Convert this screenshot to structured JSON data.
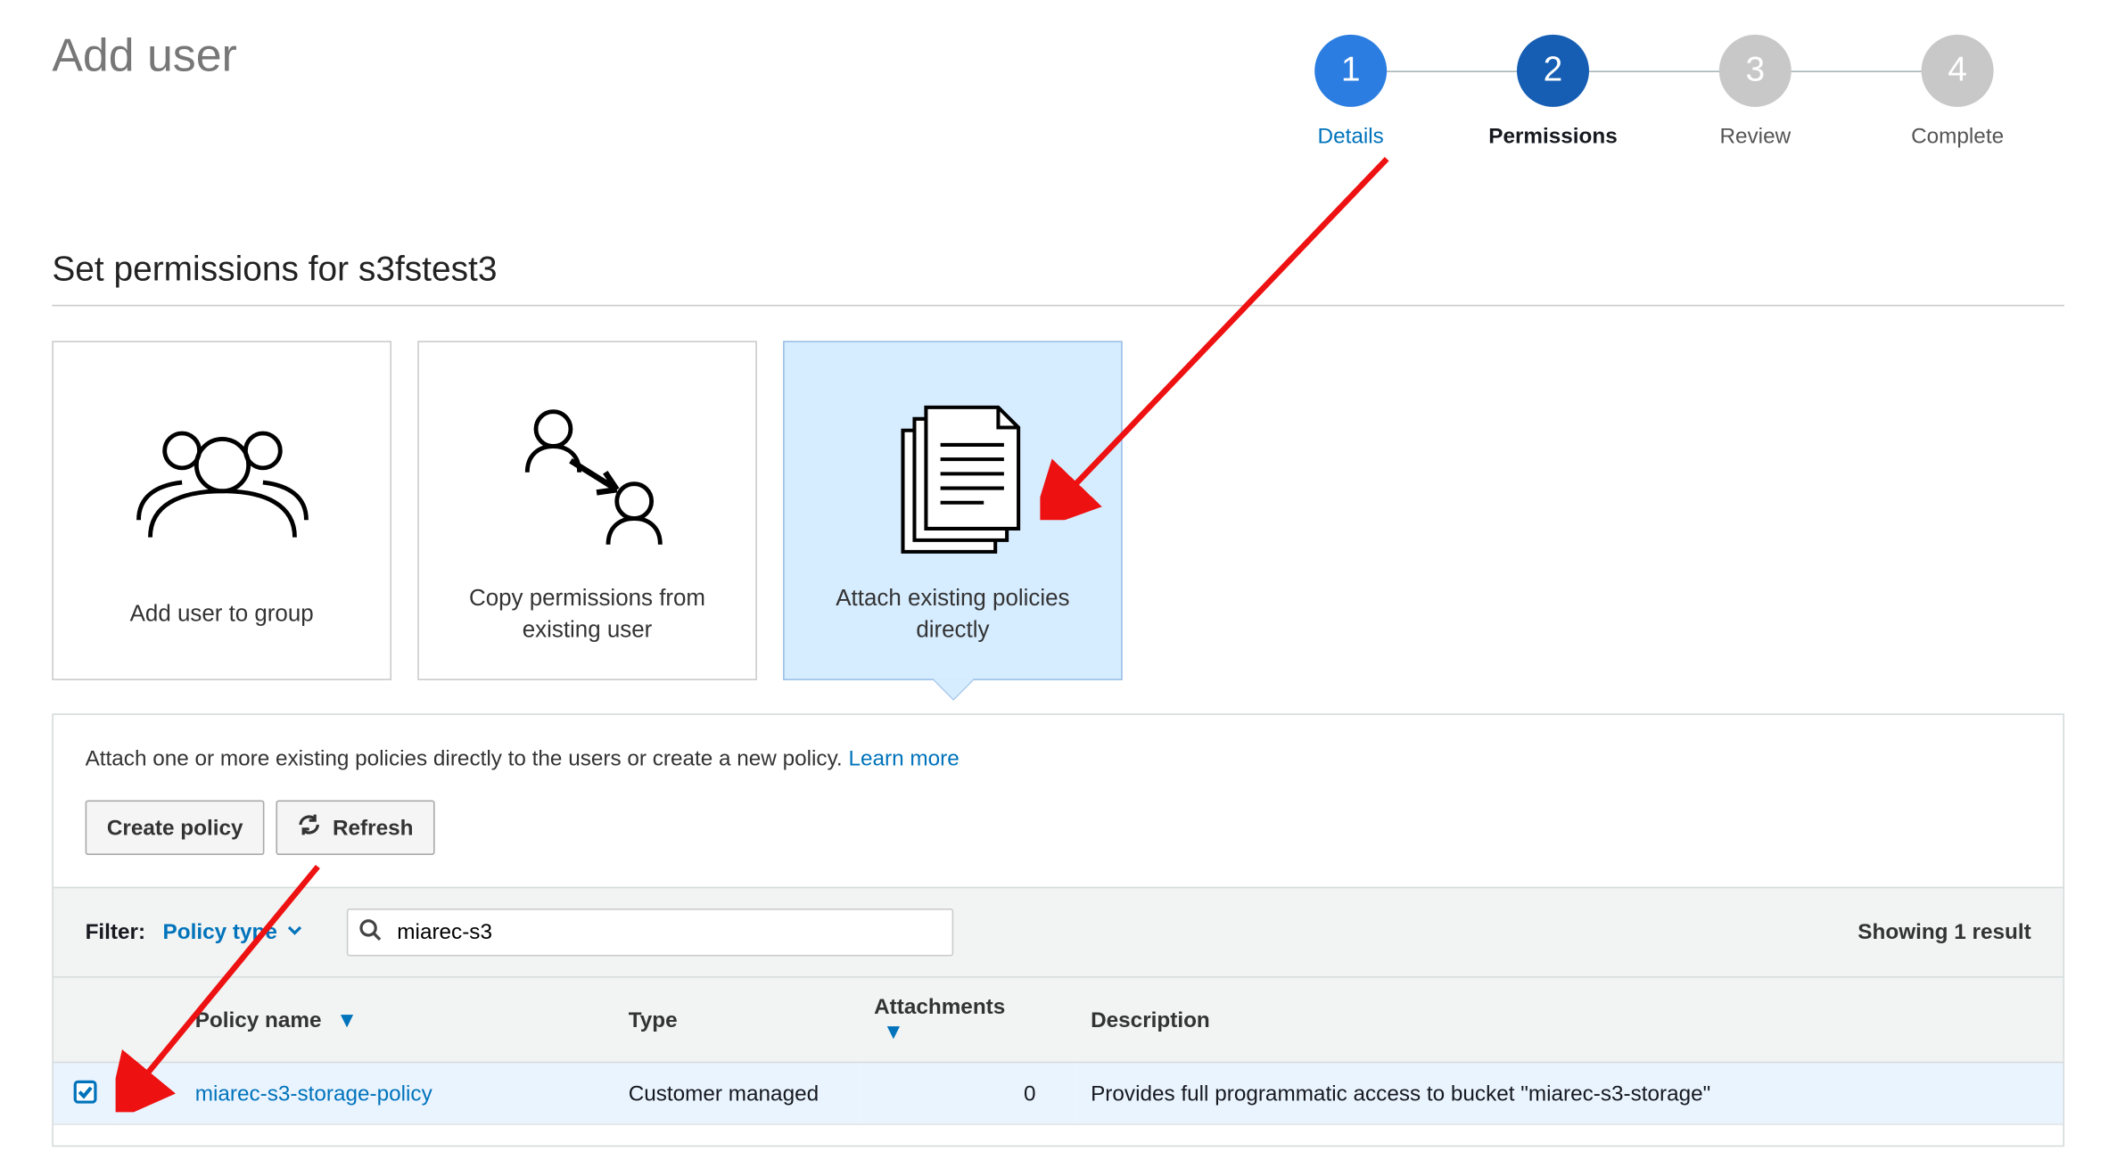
{
  "page": {
    "title": "Add user",
    "section_title": "Set permissions for s3fstest3"
  },
  "wizard": {
    "steps": [
      {
        "num": "1",
        "label": "Details"
      },
      {
        "num": "2",
        "label": "Permissions"
      },
      {
        "num": "3",
        "label": "Review"
      },
      {
        "num": "4",
        "label": "Complete"
      }
    ]
  },
  "tiles": {
    "add_group": "Add user to group",
    "copy_perm": "Copy permissions from existing user",
    "attach_policies": "Attach existing policies directly"
  },
  "panel": {
    "help_text": "Attach one or more existing policies directly to the users or create a new policy. ",
    "learn_more": "Learn more",
    "create_policy_btn": "Create policy",
    "refresh_btn": "Refresh",
    "filter_label": "Filter:",
    "filter_dropdown": "Policy type",
    "search_value": "miarec-s3",
    "result_count": "Showing 1 result"
  },
  "table": {
    "headers": {
      "policy_name": "Policy name",
      "type": "Type",
      "attachments": "Attachments",
      "description": "Description"
    },
    "rows": [
      {
        "name": "miarec-s3-storage-policy",
        "type": "Customer managed",
        "attachments": "0",
        "description": "Provides full programmatic access to bucket \"miarec-s3-storage\""
      }
    ]
  }
}
